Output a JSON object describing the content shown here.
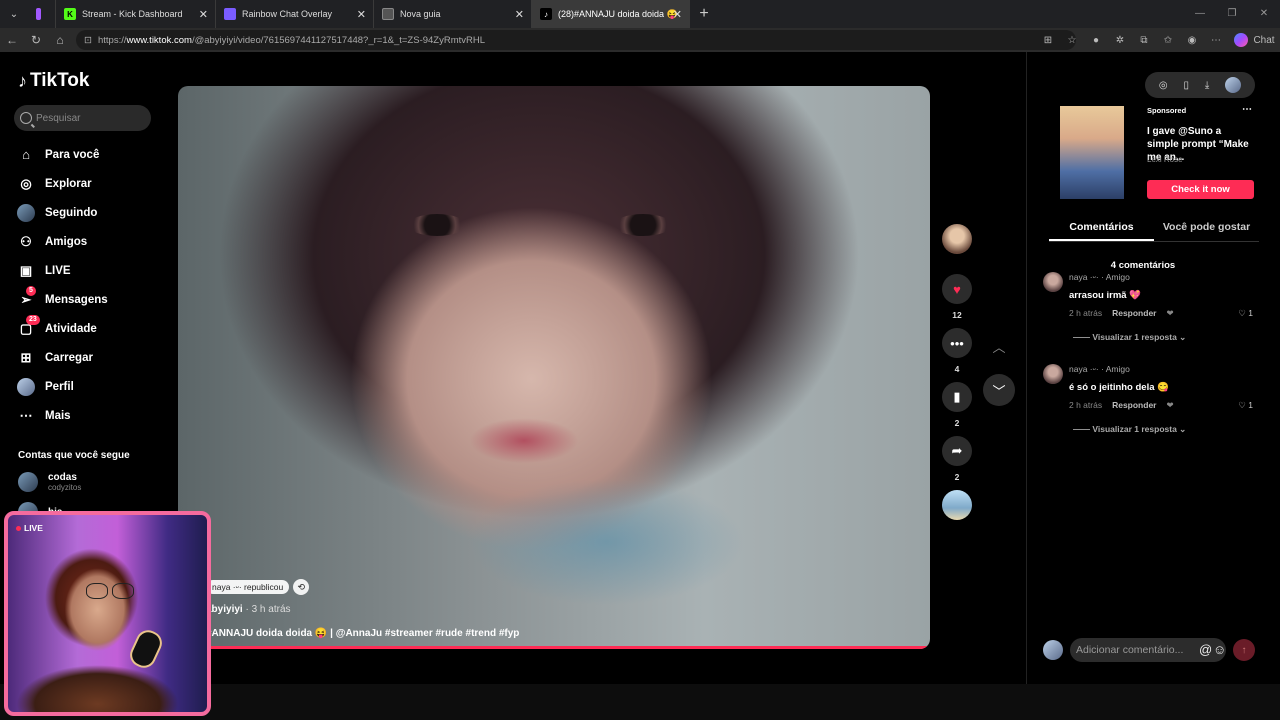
{
  "browser": {
    "tabs": [
      {
        "label": "",
        "favicon_color": "#a259ff"
      },
      {
        "label": "Stream - Kick Dashboard",
        "favicon_color": "#53fc18"
      },
      {
        "label": "Rainbow Chat Overlay",
        "favicon_color": "#7a5cff"
      },
      {
        "label": "Nova guia",
        "favicon_color": "#666666"
      },
      {
        "label": "(28)#ANNAJU doida doida 😝 | @",
        "favicon_color": "#000000",
        "active": true
      }
    ],
    "url_prefix": "https://",
    "url_host": "www.tiktok.com",
    "url_path": "/@abyiyiyi/video/7615697441127517448?_r=1&_t=ZS-94ZyRmtvRHL",
    "chat_label": "Chat"
  },
  "sidebar": {
    "logo": "TikTok",
    "search_placeholder": "Pesquisar",
    "nav": [
      {
        "label": "Para você",
        "icon": "home-icon"
      },
      {
        "label": "Explorar",
        "icon": "compass-icon"
      },
      {
        "label": "Seguindo",
        "icon": "following-icon"
      },
      {
        "label": "Amigos",
        "icon": "friends-icon"
      },
      {
        "label": "LIVE",
        "icon": "live-icon"
      },
      {
        "label": "Mensagens",
        "icon": "messages-icon",
        "badge": "5"
      },
      {
        "label": "Atividade",
        "icon": "activity-icon",
        "badge": "23"
      },
      {
        "label": "Carregar",
        "icon": "upload-icon"
      },
      {
        "label": "Perfil",
        "icon": "profile-icon"
      },
      {
        "label": "Mais",
        "icon": "more-icon"
      }
    ],
    "followed_title": "Contas que você segue",
    "followed": [
      {
        "name": "codas",
        "user": "codyzitos"
      },
      {
        "name": "bia",
        "user": ""
      }
    ]
  },
  "video": {
    "repost_text": "naya ·ᵕ· republicou",
    "author": "abyiyiyi",
    "time": " · 3 h atrás",
    "caption": "#ANNAJU doida doida 😝 | @AnnaJu #streamer #rude #trend #fyp",
    "likes": "12",
    "comments": "4",
    "saves": "2",
    "shares": "2"
  },
  "right": {
    "ad": {
      "sponsored": "Sponsored",
      "title": "I gave @Suno a simple prompt “Make me an...",
      "author": "Lexi Rose",
      "cta": "Check it now"
    },
    "tabs": [
      "Comentários",
      "Você pode gostar"
    ],
    "comment_count": "4 comentários",
    "comments": [
      {
        "user": "naya ·ᵕ· · Amigo",
        "text": "arrasou irmã 💖",
        "time": "2 h atrás",
        "reply": "Responder",
        "likes": "1",
        "replies": "Visualizar 1 resposta"
      },
      {
        "user": "naya ·ᵕ· · Amigo",
        "text": "é só o jeitinho dela 😋",
        "time": "2 h atrás",
        "reply": "Responder",
        "likes": "1",
        "replies": "Visualizar 1 resposta"
      }
    ],
    "input_placeholder": "Adicionar comentário..."
  },
  "overlay": {
    "live_label": "LIVE"
  },
  "colors": {
    "accent": "#fe2c55",
    "webcam_border": "#f56b9e"
  }
}
